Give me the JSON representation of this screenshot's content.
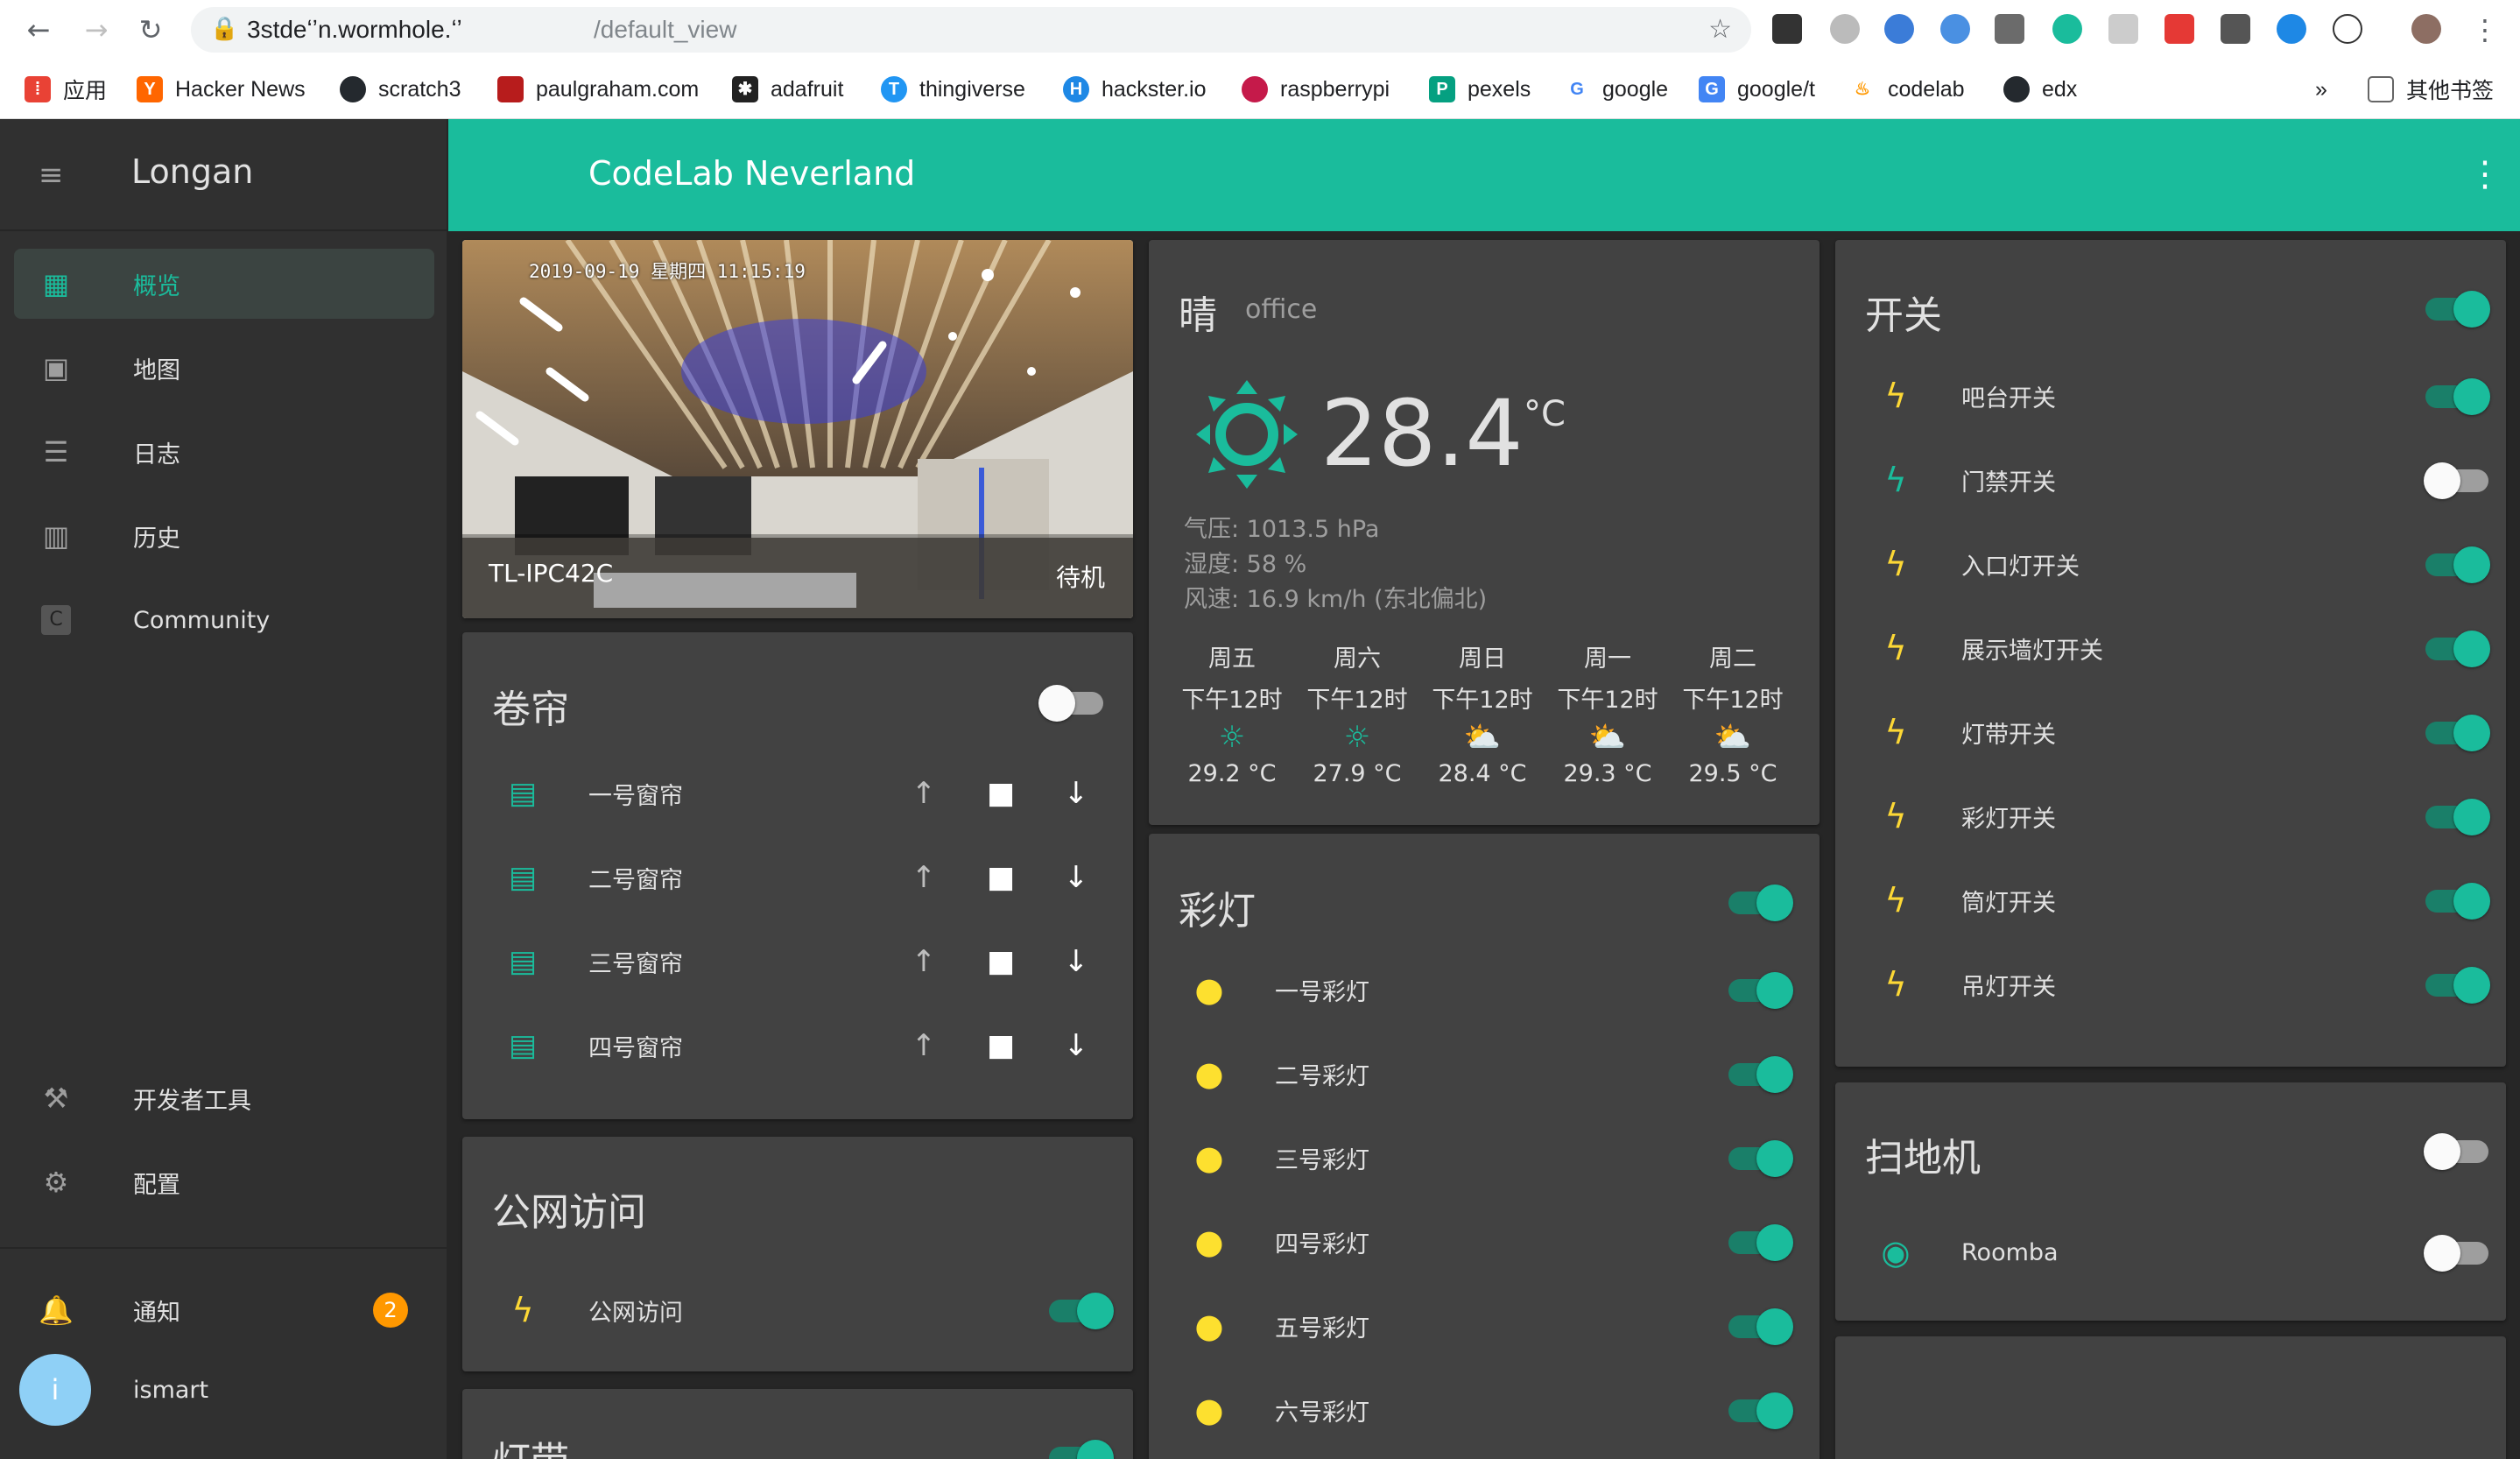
{
  "browser": {
    "url_host": "3stdeʻʼn.wormhole.ʻʼ",
    "url_path": "/default_view",
    "bookmarks": [
      "应用",
      "Hacker News",
      "scratch3",
      "paulgraham.com",
      "adafruit",
      "thingiverse",
      "hackster.io",
      "raspberrypi",
      "pexels",
      "google",
      "google/t",
      "codelab",
      "edx"
    ],
    "overflow": "»",
    "other_bookmarks": "其他书签"
  },
  "sidebar": {
    "title": "Longan",
    "items": [
      {
        "label": "概览",
        "icon": "grid-icon"
      },
      {
        "label": "地图",
        "icon": "account-box-icon"
      },
      {
        "label": "日志",
        "icon": "list-icon"
      },
      {
        "label": "历史",
        "icon": "chart-icon"
      },
      {
        "label": "Community",
        "icon": "c-icon"
      }
    ],
    "dev_tools": "开发者工具",
    "config": "配置",
    "notifications": "通知",
    "notification_count": "2",
    "user": "ismart",
    "avatar_letter": "i"
  },
  "topbar": {
    "title": "CodeLab Neverland"
  },
  "camera": {
    "timestamp": "2019-09-19 星期四 11:15:19",
    "name": "TL-IPC42C",
    "status": "待机"
  },
  "curtains": {
    "title": "卷帘",
    "toggle": false,
    "items": [
      "一号窗帘",
      "二号窗帘",
      "三号窗帘",
      "四号窗帘"
    ]
  },
  "public_access": {
    "title": "公网访问",
    "items": [
      {
        "label": "公网访问",
        "on": true
      }
    ]
  },
  "lightstrip_title": "灯带",
  "weather": {
    "condition": "晴",
    "location": "office",
    "temperature": "28.4",
    "unit": "°C",
    "pressure": "气压: 1013.5 hPa",
    "humidity": "湿度: 58 %",
    "wind": "风速: 16.9 km/h (东北偏北)",
    "forecast": [
      {
        "day": "周五",
        "time": "下午12时",
        "temp": "29.2 °C",
        "icon": "sunny-icon"
      },
      {
        "day": "周六",
        "time": "下午12时",
        "temp": "27.9 °C",
        "icon": "sunny-icon"
      },
      {
        "day": "周日",
        "time": "下午12时",
        "temp": "28.4 °C",
        "icon": "partly-cloudy-icon"
      },
      {
        "day": "周一",
        "time": "下午12时",
        "temp": "29.3 °C",
        "icon": "partly-cloudy-icon"
      },
      {
        "day": "周二",
        "time": "下午12时",
        "temp": "29.5 °C",
        "icon": "partly-cloudy-icon"
      }
    ]
  },
  "color_lights": {
    "title": "彩灯",
    "toggle": true,
    "items": [
      {
        "label": "一号彩灯",
        "on": true
      },
      {
        "label": "二号彩灯",
        "on": true
      },
      {
        "label": "三号彩灯",
        "on": true
      },
      {
        "label": "四号彩灯",
        "on": true
      },
      {
        "label": "五号彩灯",
        "on": true
      },
      {
        "label": "六号彩灯",
        "on": true
      }
    ]
  },
  "switches": {
    "title": "开关",
    "toggle": true,
    "items": [
      {
        "label": "吧台开关",
        "on": true
      },
      {
        "label": "门禁开关",
        "on": false
      },
      {
        "label": "入口灯开关",
        "on": true
      },
      {
        "label": "展示墙灯开关",
        "on": true
      },
      {
        "label": "灯带开关",
        "on": true
      },
      {
        "label": "彩灯开关",
        "on": true
      },
      {
        "label": "筒灯开关",
        "on": true
      },
      {
        "label": "吊灯开关",
        "on": true
      }
    ]
  },
  "vacuum": {
    "title": "扫地机",
    "toggle": false,
    "items": [
      {
        "label": "Roomba",
        "on": false
      }
    ]
  },
  "colors": {
    "accent": "#1abc9c",
    "bolt": "#fdd835",
    "badge": "#ff9800"
  }
}
